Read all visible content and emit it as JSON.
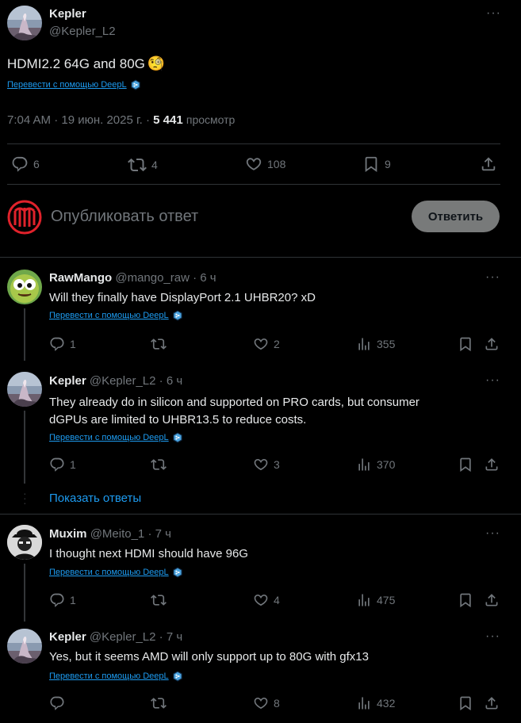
{
  "main_post": {
    "author_name": "Kepler",
    "author_handle": "@Kepler_L2",
    "text": "HDMI2.2 64G and 80G",
    "emoji": "🧐",
    "translate_label": "Перевести с помощью DeepL",
    "time": "7:04 AM · 19 июн. 2025 г. · ",
    "views_count": "5 441",
    "views_label": "просмотр",
    "replies": "6",
    "reposts": "4",
    "likes": "108",
    "bookmarks": "9"
  },
  "composer": {
    "placeholder": "Опубликовать ответ",
    "button": "Ответить"
  },
  "replies": [
    {
      "name": "RawMango",
      "handle": "@mango_raw",
      "time": "· 6 ч",
      "text": "Will they finally have DisplayPort 2.1 UHBR20? xD",
      "translate": "Перевести с помощью DeepL",
      "replies": "1",
      "reposts": "",
      "likes": "2",
      "views": "355"
    },
    {
      "name": "Kepler",
      "handle": "@Kepler_L2",
      "time": "· 6 ч",
      "text_line1": "They already do in silicon and supported on PRO cards, but consumer",
      "text_line2": "dGPUs are limited to UHBR13.5 to reduce costs.",
      "translate": "Перевести с помощью DeepL",
      "replies": "1",
      "reposts": "",
      "likes": "3",
      "views": "370",
      "show_replies": "Показать ответы"
    },
    {
      "name": "Muxim",
      "handle": "@Meito_1",
      "time": "· 7 ч",
      "text": "I thought next HDMI should have 96G",
      "translate": "Перевести с помощью DeepL",
      "replies": "1",
      "reposts": "",
      "likes": "4",
      "views": "475"
    },
    {
      "name": "Kepler",
      "handle": "@Kepler_L2",
      "time": "· 7 ч",
      "text": "Yes, but it seems AMD will only support up to 80G with gfx13",
      "translate": "Перевести с помощью DeepL",
      "replies": "",
      "reposts": "",
      "likes": "8",
      "views": "432"
    }
  ],
  "colors": {
    "accent": "#1d9bf0",
    "muted": "#71767b",
    "text": "#e7e9ea",
    "divider": "#2f3336",
    "brand_red": "#e0222b"
  }
}
